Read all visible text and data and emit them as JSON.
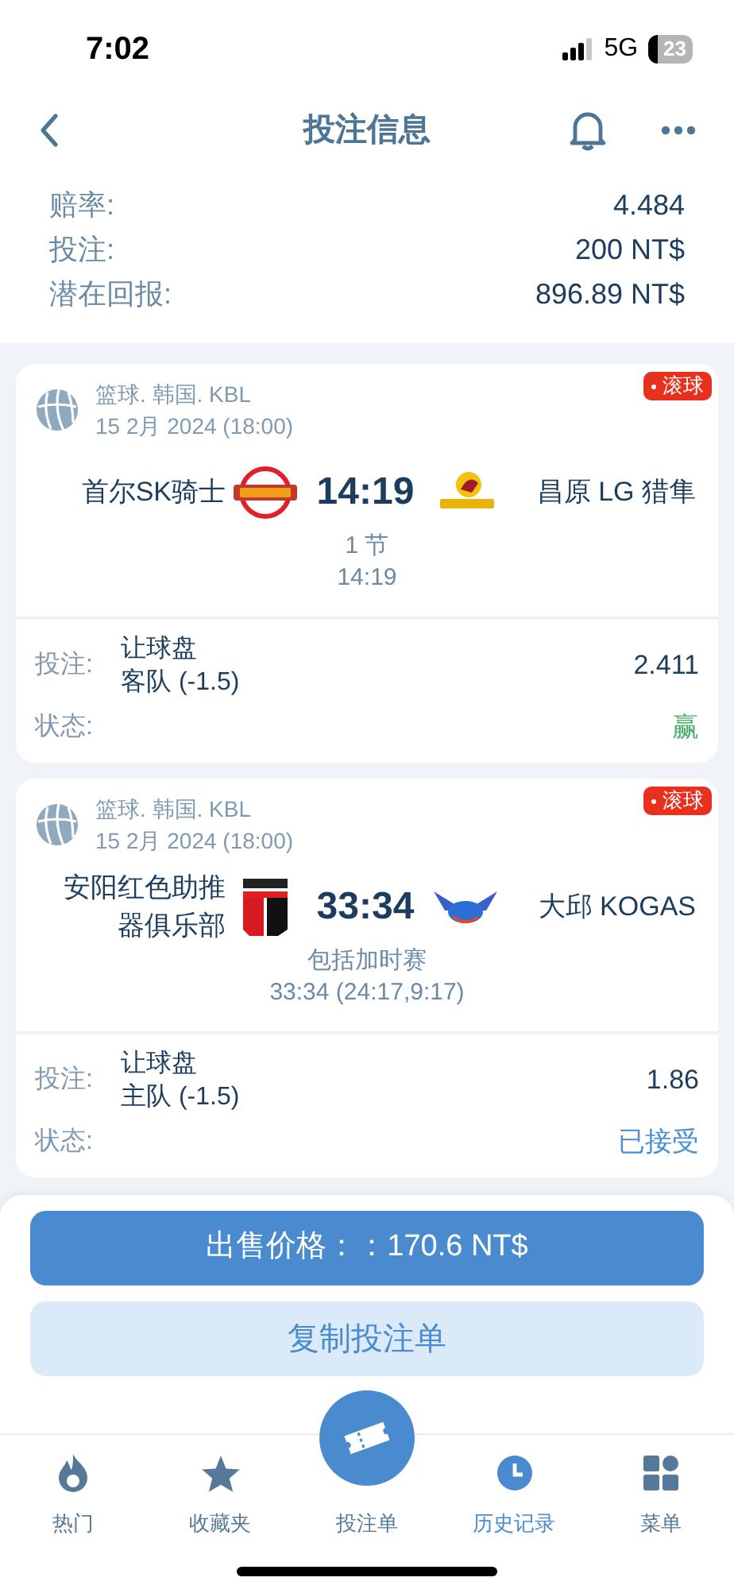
{
  "status_bar": {
    "time": "7:02",
    "network": "5G",
    "battery": "23"
  },
  "header": {
    "title": "投注信息"
  },
  "summary": [
    {
      "label": "赔率:",
      "value": "4.484"
    },
    {
      "label": "投注:",
      "value": "200 NT$"
    },
    {
      "label": "潜在回报:",
      "value": "896.89 NT$"
    }
  ],
  "bets": [
    {
      "league": "篮球. 韩国. KBL",
      "date": "15 2月 2024 (18:00)",
      "live_badge": "滚球",
      "home": "首尔SK骑士",
      "away": "昌原 LG 猎隼",
      "score": "14:19",
      "period": "1 节",
      "detail": "14:19",
      "bet_label": "投注:",
      "market": "让球盘",
      "selection": "客队 (-1.5)",
      "odds": "2.411",
      "status_label": "状态:",
      "status": "赢",
      "color": "#4caf6a"
    },
    {
      "league": "篮球. 韩国. KBL",
      "date": "15 2月 2024 (18:00)",
      "live_badge": "滚球",
      "home": "安阳红色助推器俱乐部",
      "away": "大邱 KOGAS",
      "score": "33:34",
      "period": "包括加时赛",
      "detail": "33:34 (24:17,9:17)",
      "bet_label": "投注:",
      "market": "让球盘",
      "selection": "主队 (-1.5)",
      "odds": "1.86",
      "status_label": "状态:",
      "status": "已接受",
      "color": "#4a8fd4"
    }
  ],
  "sell_button": "出售价格：：170.6 NT$",
  "copy_button": "复制投注单",
  "nav": [
    {
      "label": "热门",
      "kind": "fire",
      "selected": false
    },
    {
      "label": "收藏夹",
      "kind": "star",
      "selected": false
    },
    {
      "label": "投注单",
      "kind": "ticket",
      "selected": false
    },
    {
      "label": "历史记录",
      "kind": "clock",
      "selected": true
    },
    {
      "label": "菜单",
      "kind": "grid",
      "selected": false
    }
  ]
}
